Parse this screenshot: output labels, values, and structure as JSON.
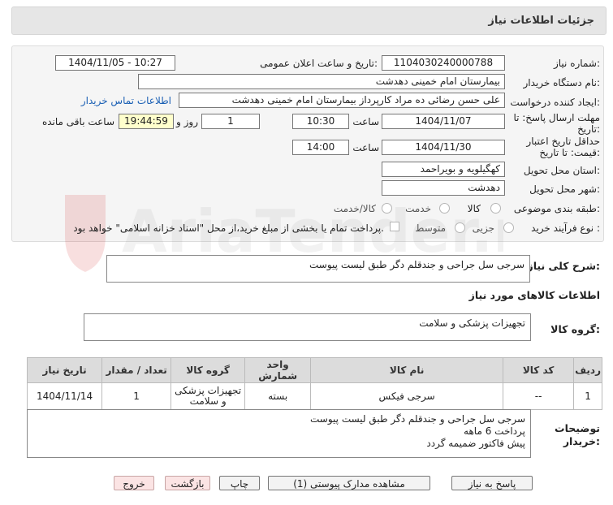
{
  "header": {
    "title": "جزئیات اطلاعات نیاز"
  },
  "form": {
    "need_number": {
      "label": "شماره نیاز:",
      "value": "1104030240000788"
    },
    "announce": {
      "label": "تاریخ و ساعت اعلان عمومی:",
      "value": "1404/11/05 - 10:27"
    },
    "buyer_org": {
      "label": "نام دستگاه خریدار:",
      "value": "بیمارستان امام خمینی دهدشت"
    },
    "requester": {
      "label": "ایجاد کننده درخواست:",
      "value": "علی حسن رضائی ده مراد کارپرداز بیمارستان امام خمینی دهدشت",
      "contact_link": "اطلاعات تماس خریدار"
    },
    "deadline": {
      "label_1": "مهلت ارسال پاسخ: تا",
      "label_2": "تاریخ:",
      "date": "1404/11/07",
      "time_label": "ساعت",
      "time": "10:30",
      "days": "1",
      "days_label": "روز و",
      "remaining": "19:44:59",
      "remaining_label": "ساعت باقی مانده"
    },
    "price_validity": {
      "label_1": "حداقل تاریخ اعتبار",
      "label_2": "قیمت: تا تاریخ:",
      "date": "1404/11/30",
      "time_label": "ساعت",
      "time": "14:00"
    },
    "province": {
      "label": "استان محل تحویل:",
      "value": "کهگیلویه و بویراحمد"
    },
    "city": {
      "label": "شهر محل تحویل:",
      "value": "دهدشت"
    },
    "category": {
      "label": "طبقه بندی موضوعی:",
      "options": [
        "کالا",
        "خدمت",
        "کالا/خدمت"
      ]
    },
    "process": {
      "label": "نوع فرآیند خرید :",
      "options": [
        "جزیی",
        "متوسط"
      ],
      "note": "پرداخت تمام یا بخشی از مبلغ خرید،از محل \"اسناد خزانه اسلامی\" خواهد بود."
    }
  },
  "description": {
    "label": "شرح کلی نیاز:",
    "value": "سرجی سل جراحی و جندقلم دگر طبق لیست پیوست"
  },
  "goods_info_title": "اطلاعات کالاهای مورد نیاز",
  "goods_group": {
    "label": "گروه کالا:",
    "value": "تجهیزات پزشکی و سلامت"
  },
  "table": {
    "headers": [
      "ردیف",
      "کد کالا",
      "نام کالا",
      "واحد شمارش",
      "گروه کالا",
      "تعداد / مقدار",
      "تاریخ نیاز"
    ],
    "rows": [
      {
        "row": "1",
        "code": "--",
        "name": "سرجی فیکس",
        "unit": "بسته",
        "group": "تجهیزات پزشکی و سلامت",
        "qty": "1",
        "date": "1404/11/14"
      }
    ]
  },
  "buyer_notes": {
    "label_1": "توضیحات",
    "label_2": "خریدار:",
    "lines": [
      "سرجی سل جراحی و جندقلم دگر طبق لیست پیوست",
      "پرداخت 6 ماهه",
      "پیش فاکتور ضمیمه گردد"
    ]
  },
  "buttons": {
    "reply": "پاسخ به نیاز",
    "attachments": "مشاهده مدارک پیوستی (1)",
    "print": "چاپ",
    "back": "بازگشت",
    "exit": "خروج"
  },
  "watermark": "AriaTender.net"
}
